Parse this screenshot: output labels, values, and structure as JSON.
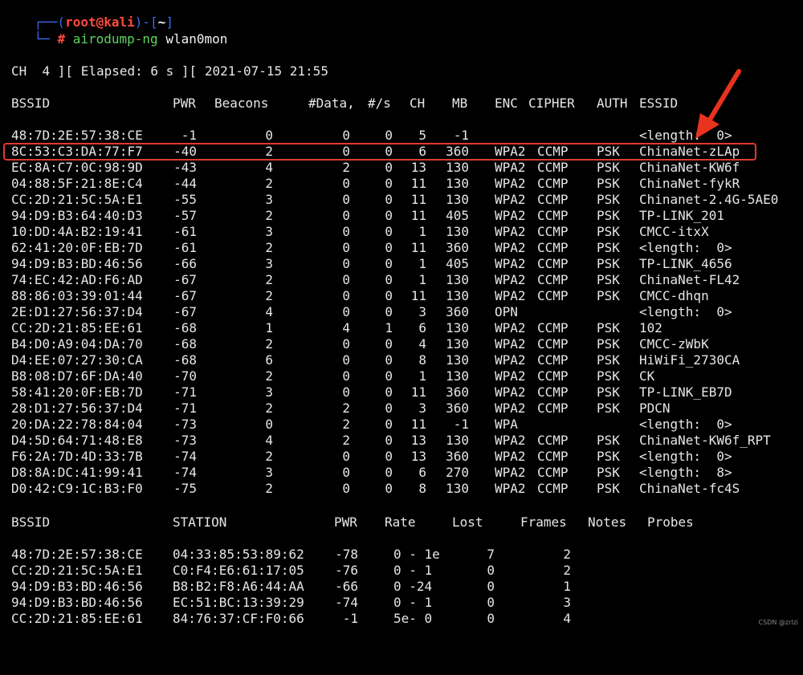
{
  "prompt": {
    "line1_prefix": "┌──(",
    "user": "root@kali",
    "line1_mid": ")-[",
    "dir": "~",
    "line1_suffix": "]",
    "line2_prefix": "└─",
    "hash": "#",
    "command": "airodump-ng",
    "argument": "wlan0mon"
  },
  "status_line": "CH  4 ][ Elapsed: 6 s ][ 2021-07-15 21:55",
  "ap_table": {
    "headers": [
      "BSSID",
      "PWR",
      "Beacons",
      "#Data,",
      "#/s",
      "CH",
      "MB",
      "ENC",
      "CIPHER",
      "AUTH",
      "ESSID"
    ],
    "rows": [
      [
        "48:7D:2E:57:38:CE",
        "-1",
        "0",
        "0",
        "0",
        "5",
        "-1",
        "",
        "",
        "",
        "<length:  0>"
      ],
      [
        "8C:53:C3:DA:77:F7",
        "-40",
        "2",
        "0",
        "0",
        "6",
        "360",
        "WPA2",
        "CCMP",
        "PSK",
        "ChinaNet-zLAp"
      ],
      [
        "EC:8A:C7:0C:98:9D",
        "-43",
        "4",
        "2",
        "0",
        "13",
        "130",
        "WPA2",
        "CCMP",
        "PSK",
        "ChinaNet-KW6f"
      ],
      [
        "04:88:5F:21:8E:C4",
        "-44",
        "2",
        "0",
        "0",
        "11",
        "130",
        "WPA2",
        "CCMP",
        "PSK",
        "ChinaNet-fykR"
      ],
      [
        "CC:2D:21:5C:5A:E1",
        "-55",
        "3",
        "0",
        "0",
        "11",
        "130",
        "WPA2",
        "CCMP",
        "PSK",
        "Chinanet-2.4G-5AE0"
      ],
      [
        "94:D9:B3:64:40:D3",
        "-57",
        "2",
        "0",
        "0",
        "11",
        "405",
        "WPA2",
        "CCMP",
        "PSK",
        "TP-LINK_201"
      ],
      [
        "10:DD:4A:B2:19:41",
        "-61",
        "3",
        "0",
        "0",
        "1",
        "130",
        "WPA2",
        "CCMP",
        "PSK",
        "CMCC-itxX"
      ],
      [
        "62:41:20:0F:EB:7D",
        "-61",
        "2",
        "0",
        "0",
        "11",
        "360",
        "WPA2",
        "CCMP",
        "PSK",
        "<length:  0>"
      ],
      [
        "94:D9:B3:BD:46:56",
        "-66",
        "3",
        "0",
        "0",
        "1",
        "405",
        "WPA2",
        "CCMP",
        "PSK",
        "TP-LINK_4656"
      ],
      [
        "74:EC:42:AD:F6:AD",
        "-67",
        "2",
        "0",
        "0",
        "1",
        "130",
        "WPA2",
        "CCMP",
        "PSK",
        "ChinaNet-FL42"
      ],
      [
        "88:86:03:39:01:44",
        "-67",
        "2",
        "0",
        "0",
        "11",
        "130",
        "WPA2",
        "CCMP",
        "PSK",
        "CMCC-dhqn"
      ],
      [
        "2E:D1:27:56:37:D4",
        "-67",
        "4",
        "0",
        "0",
        "3",
        "360",
        "OPN",
        "",
        "",
        "<length:  0>"
      ],
      [
        "CC:2D:21:85:EE:61",
        "-68",
        "1",
        "4",
        "1",
        "6",
        "130",
        "WPA2",
        "CCMP",
        "PSK",
        "102"
      ],
      [
        "B4:D0:A9:04:DA:70",
        "-68",
        "2",
        "0",
        "0",
        "4",
        "130",
        "WPA2",
        "CCMP",
        "PSK",
        "CMCC-zWbK"
      ],
      [
        "D4:EE:07:27:30:CA",
        "-68",
        "6",
        "0",
        "0",
        "8",
        "130",
        "WPA2",
        "CCMP",
        "PSK",
        "HiWiFi_2730CA"
      ],
      [
        "B8:08:D7:6F:DA:40",
        "-70",
        "2",
        "0",
        "0",
        "1",
        "130",
        "WPA2",
        "CCMP",
        "PSK",
        "CK"
      ],
      [
        "58:41:20:0F:EB:7D",
        "-71",
        "3",
        "0",
        "0",
        "11",
        "360",
        "WPA2",
        "CCMP",
        "PSK",
        "TP-LINK_EB7D"
      ],
      [
        "28:D1:27:56:37:D4",
        "-71",
        "2",
        "2",
        "0",
        "3",
        "360",
        "WPA2",
        "CCMP",
        "PSK",
        "PDCN"
      ],
      [
        "20:DA:22:78:84:04",
        "-73",
        "0",
        "2",
        "0",
        "11",
        "-1",
        "WPA",
        "",
        "",
        "<length:  0>"
      ],
      [
        "D4:5D:64:71:48:E8",
        "-73",
        "4",
        "2",
        "0",
        "13",
        "130",
        "WPA2",
        "CCMP",
        "PSK",
        "ChinaNet-KW6f_RPT"
      ],
      [
        "F6:2A:7D:4D:33:7B",
        "-74",
        "2",
        "0",
        "0",
        "13",
        "360",
        "WPA2",
        "CCMP",
        "PSK",
        "<length:  0>"
      ],
      [
        "D8:8A:DC:41:99:41",
        "-74",
        "3",
        "0",
        "0",
        "6",
        "270",
        "WPA2",
        "CCMP",
        "PSK",
        "<length:  8>"
      ],
      [
        "D0:42:C9:1C:B3:F0",
        "-75",
        "2",
        "0",
        "0",
        "8",
        "130",
        "WPA2",
        "CCMP",
        "PSK",
        "ChinaNet-fc4S"
      ]
    ]
  },
  "station_table": {
    "headers": [
      "BSSID",
      "STATION",
      "PWR",
      "Rate",
      "Lost",
      "Frames",
      "Notes",
      "Probes"
    ],
    "rows": [
      [
        "48:7D:2E:57:38:CE",
        "04:33:85:53:89:62",
        "-78",
        "0 - 1e",
        "7",
        "2"
      ],
      [
        "CC:2D:21:5C:5A:E1",
        "C0:F4:E6:61:17:05",
        "-76",
        "0 - 1",
        "0",
        "2"
      ],
      [
        "94:D9:B3:BD:46:56",
        "B8:B2:F8:A6:44:AA",
        "-66",
        "0 -24",
        "0",
        "1"
      ],
      [
        "94:D9:B3:BD:46:56",
        "EC:51:BC:13:39:29",
        "-74",
        "0 - 1",
        "0",
        "3"
      ],
      [
        "CC:2D:21:85:EE:61",
        "84:76:37:CF:F0:66",
        "-1",
        "5e- 0",
        "0",
        "4"
      ]
    ]
  },
  "watermark": "CSDN @zrlzi",
  "colors": {
    "highlight": "#e03a2b",
    "prompt_blue": "#3b6cf0",
    "prompt_red": "#ff4a3d",
    "command_green": "#5fd35f"
  }
}
